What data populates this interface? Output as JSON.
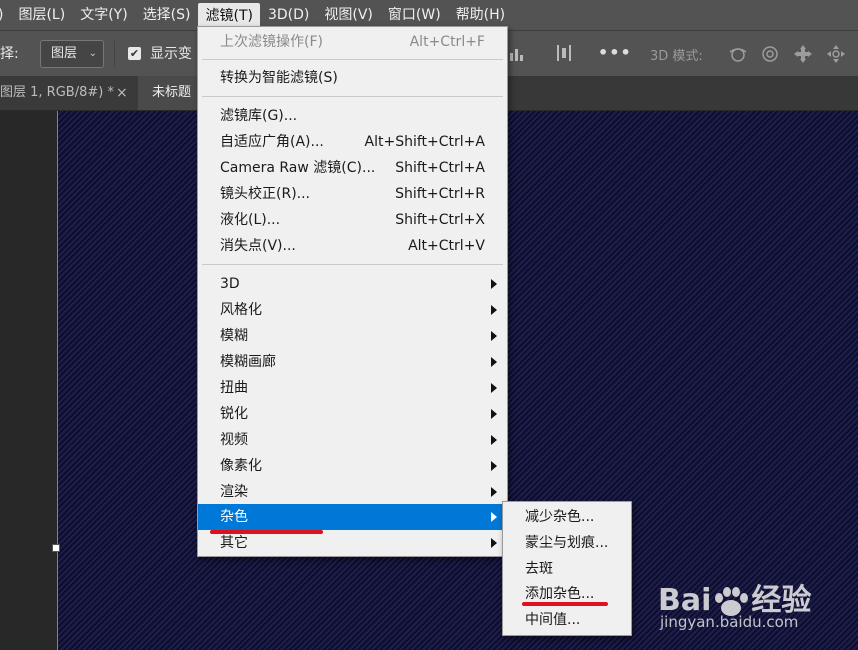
{
  "menubar": {
    "items": [
      {
        "label": ")"
      },
      {
        "label": "图层(L)"
      },
      {
        "label": "文字(Y)"
      },
      {
        "label": "选择(S)"
      },
      {
        "label": "滤镜(T)"
      },
      {
        "label": "3D(D)"
      },
      {
        "label": "视图(V)"
      },
      {
        "label": "窗口(W)"
      },
      {
        "label": "帮助(H)"
      }
    ]
  },
  "options": {
    "select_label": "择:",
    "dropdown_value": "图层",
    "show_label": "显示变",
    "dots": "•••",
    "mode_label": "3D 模式:"
  },
  "tabs": [
    {
      "label": "图层 1, RGB/8#) *",
      "close": "×"
    },
    {
      "label": "未标题"
    }
  ],
  "filter_menu": {
    "items": [
      {
        "label": "上次滤镜操作(F)",
        "shortcut": "Alt+Ctrl+F"
      },
      {
        "label": "转换为智能滤镜(S)"
      },
      {
        "label": "滤镜库(G)..."
      },
      {
        "label": "自适应广角(A)...",
        "shortcut": "Alt+Shift+Ctrl+A"
      },
      {
        "label": "Camera Raw 滤镜(C)...",
        "shortcut": "Shift+Ctrl+A"
      },
      {
        "label": "镜头校正(R)...",
        "shortcut": "Shift+Ctrl+R"
      },
      {
        "label": "液化(L)...",
        "shortcut": "Shift+Ctrl+X"
      },
      {
        "label": "消失点(V)...",
        "shortcut": "Alt+Ctrl+V"
      },
      {
        "label": "3D"
      },
      {
        "label": "风格化"
      },
      {
        "label": "模糊"
      },
      {
        "label": "模糊画廊"
      },
      {
        "label": "扭曲"
      },
      {
        "label": "锐化"
      },
      {
        "label": "视频"
      },
      {
        "label": "像素化"
      },
      {
        "label": "渲染"
      },
      {
        "label": "杂色"
      },
      {
        "label": "其它"
      }
    ]
  },
  "noise_submenu": {
    "items": [
      {
        "label": "减少杂色..."
      },
      {
        "label": "蒙尘与划痕..."
      },
      {
        "label": "去斑"
      },
      {
        "label": "添加杂色..."
      },
      {
        "label": "中间值..."
      }
    ]
  },
  "watermark": {
    "logo_left": "Bai",
    "logo_right": "经验",
    "url": "jingyan.baidu.com"
  },
  "colors": {
    "menu_bg": "#535353",
    "highlight": "#0078d7",
    "annotation_red": "#e0101e"
  }
}
